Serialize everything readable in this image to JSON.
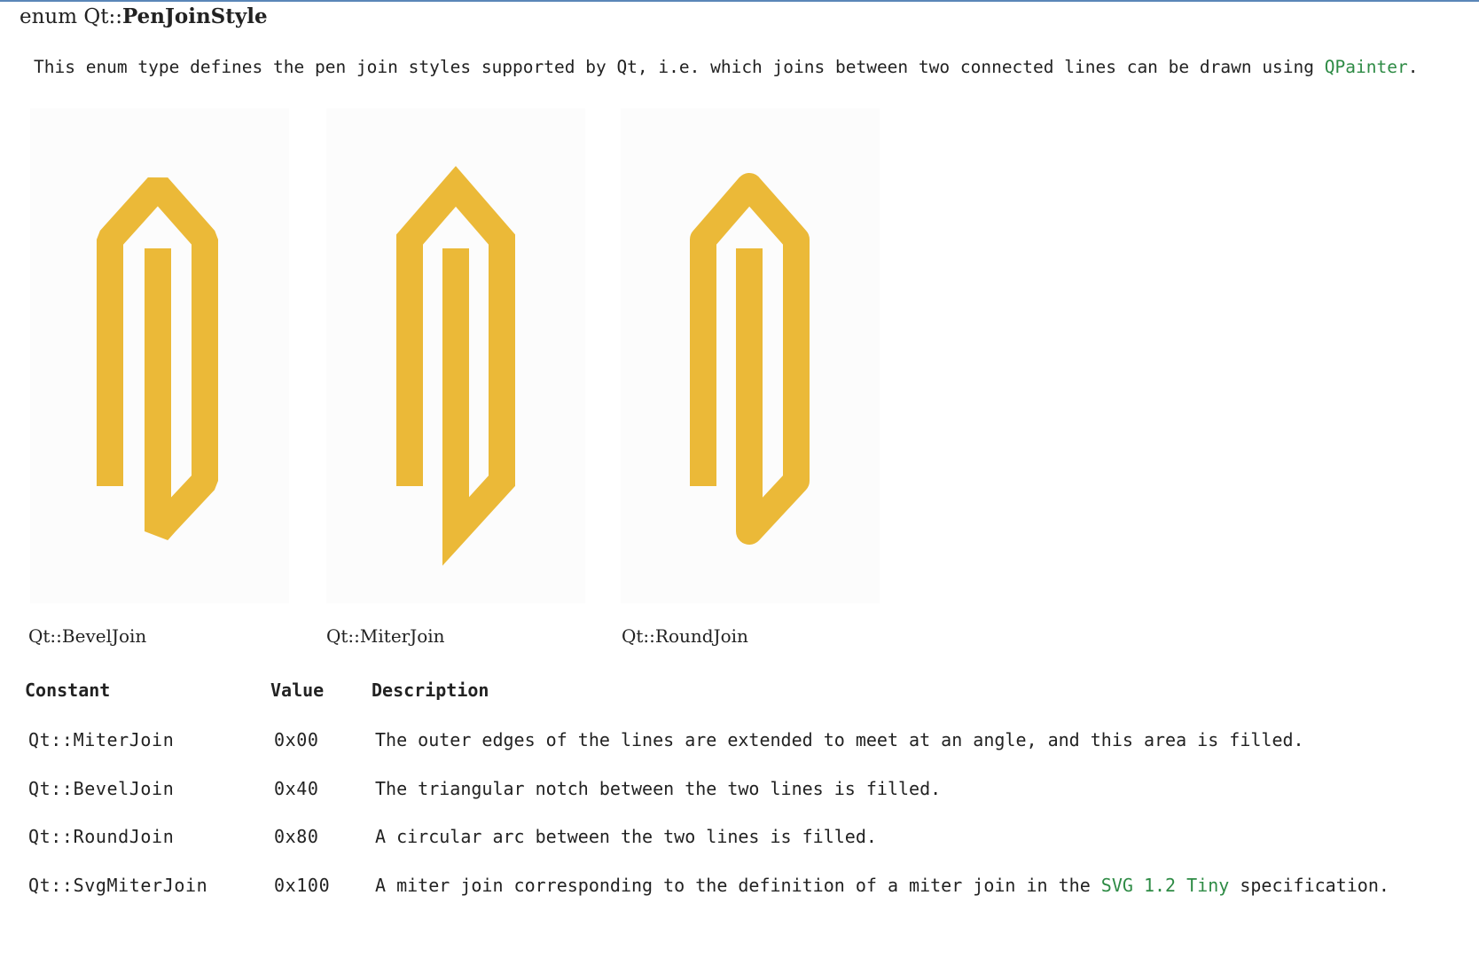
{
  "enum": {
    "prefix": "enum ",
    "scope": "Qt::",
    "name": "PenJoinStyle"
  },
  "intro": {
    "text": "This enum type defines the pen join styles supported by Qt, i.e. which joins between two connected lines can be drawn using ",
    "link": "QPainter",
    "suffix": "."
  },
  "figures": [
    {
      "caption": "Qt::BevelJoin",
      "join": "bevel"
    },
    {
      "caption": "Qt::MiterJoin",
      "join": "miter"
    },
    {
      "caption": "Qt::RoundJoin",
      "join": "round"
    }
  ],
  "table": {
    "headers": {
      "constant": "Constant",
      "value": "Value",
      "description": "Description"
    },
    "rows": [
      {
        "constant": "Qt::MiterJoin",
        "value": "0x00",
        "description": "The outer edges of the lines are extended to meet at an angle, and this area is filled."
      },
      {
        "constant": "Qt::BevelJoin",
        "value": "0x40",
        "description": "The triangular notch between the two lines is filled."
      },
      {
        "constant": "Qt::RoundJoin",
        "value": "0x80",
        "description": "A circular arc between the two lines is filled."
      },
      {
        "constant": "Qt::SvgMiterJoin",
        "value": "0x100",
        "description_prefix": "A miter join corresponding to the definition of a miter join in the ",
        "description_link": "SVG 1.2 Tiny",
        "description_suffix": " specification."
      }
    ]
  },
  "colors": {
    "link": "#2e8b45",
    "stroke": "#ebb938",
    "rule": "#5a86b8"
  }
}
